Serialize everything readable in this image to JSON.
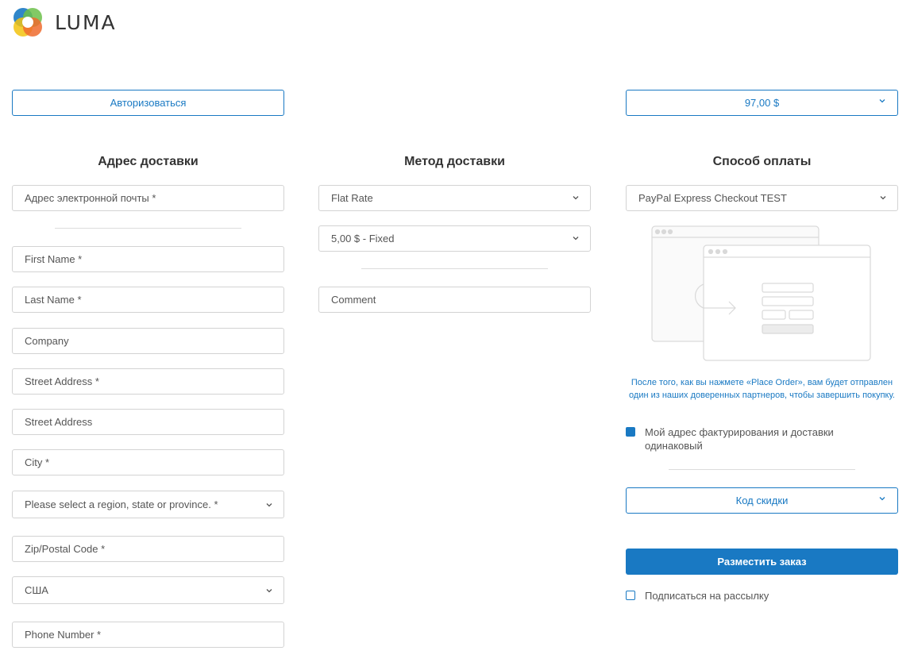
{
  "brand": {
    "name": "LUMA"
  },
  "header": {
    "login_label": "Авторизоваться",
    "cart_total": "97,00 $"
  },
  "shipping_address": {
    "title": "Адрес доставки",
    "email_placeholder": "Адрес электронной почты *",
    "fields": {
      "first_name": "First Name *",
      "last_name": "Last Name *",
      "company": "Company",
      "street_1": "Street Address *",
      "street_2": "Street Address",
      "city": "City *",
      "region": "Please select a region, state or province. *",
      "zip": "Zip/Postal Code *",
      "country": "США",
      "phone": "Phone Number *"
    }
  },
  "shipping_method": {
    "title": "Метод доставки",
    "carrier": "Flat Rate",
    "rate": "5,00 $ - Fixed",
    "comment_placeholder": "Comment"
  },
  "payment": {
    "title": "Способ оплаты",
    "method": "PayPal Express Checkout TEST",
    "note": "После того, как вы нажмете «Place Order», вам будет отправлен один из наших доверенных партнеров, чтобы завершить покупку.",
    "same_address_label": "Мой адрес фактурирования и доставки одинаковый",
    "same_address_checked": true,
    "discount_label": "Код скидки",
    "place_order_label": "Разместить заказ",
    "newsletter_label": "Подписаться на рассылку",
    "newsletter_checked": false
  },
  "colors": {
    "accent": "#1979c3",
    "border": "#d3d3d3",
    "text": "#333333"
  }
}
